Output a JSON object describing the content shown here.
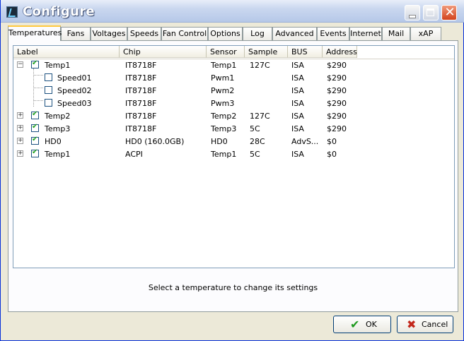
{
  "window": {
    "title": "Configure"
  },
  "tabs": [
    "Temperatures",
    "Fans",
    "Voltages",
    "Speeds",
    "Fan Control",
    "Options",
    "Log",
    "Advanced",
    "Events",
    "Internet",
    "Mail",
    "xAP"
  ],
  "active_tab": "Temperatures",
  "columns": [
    "Label",
    "Chip",
    "Sensor",
    "Sample",
    "BUS",
    "Address"
  ],
  "rows": [
    {
      "label": "Temp1",
      "chip": "IT8718F",
      "sensor": "Temp1",
      "sample": "127C",
      "bus": "ISA",
      "address": "$290",
      "checked": true,
      "expander": "minus",
      "level": 0
    },
    {
      "label": "Speed01",
      "chip": "IT8718F",
      "sensor": "Pwm1",
      "sample": "",
      "bus": "ISA",
      "address": "$290",
      "checked": false,
      "expander": "",
      "level": 1
    },
    {
      "label": "Speed02",
      "chip": "IT8718F",
      "sensor": "Pwm2",
      "sample": "",
      "bus": "ISA",
      "address": "$290",
      "checked": false,
      "expander": "",
      "level": 1
    },
    {
      "label": "Speed03",
      "chip": "IT8718F",
      "sensor": "Pwm3",
      "sample": "",
      "bus": "ISA",
      "address": "$290",
      "checked": false,
      "expander": "",
      "level": 1
    },
    {
      "label": "Temp2",
      "chip": "IT8718F",
      "sensor": "Temp2",
      "sample": "127C",
      "bus": "ISA",
      "address": "$290",
      "checked": true,
      "expander": "plus",
      "level": 0
    },
    {
      "label": "Temp3",
      "chip": "IT8718F",
      "sensor": "Temp3",
      "sample": "5C",
      "bus": "ISA",
      "address": "$290",
      "checked": true,
      "expander": "plus",
      "level": 0
    },
    {
      "label": "HD0",
      "chip": "HD0 (160.0GB)",
      "sensor": "HD0",
      "sample": "28C",
      "bus": "AdvS...",
      "address": "$0",
      "checked": true,
      "expander": "plus",
      "level": 0
    },
    {
      "label": "Temp1",
      "chip": "ACPI",
      "sensor": "Temp1",
      "sample": "5C",
      "bus": "ISA",
      "address": "$0",
      "checked": true,
      "expander": "plus",
      "level": 0
    }
  ],
  "status_text": "Select a temperature to change its settings",
  "buttons": {
    "ok": "OK",
    "cancel": "Cancel"
  },
  "icons": {
    "ok": "checkmark-icon",
    "cancel": "x-icon"
  },
  "colors": {
    "title_bg": "#C9D7EF",
    "tab_highlight": "#FFC83C",
    "check_green": "#21A121"
  }
}
